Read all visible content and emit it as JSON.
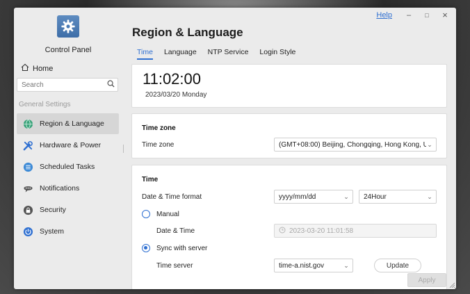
{
  "window": {
    "help_label": "Help",
    "minimize_glyph": "–",
    "maximize_glyph": "□",
    "close_glyph": "×"
  },
  "sidebar": {
    "app_title": "Control Panel",
    "home_label": "Home",
    "search_placeholder": "Search",
    "section_label": "General Settings",
    "items": [
      {
        "label": "Region & Language",
        "icon": "globe-icon",
        "active": true
      },
      {
        "label": "Hardware & Power",
        "icon": "tools-icon",
        "active": false
      },
      {
        "label": "Scheduled Tasks",
        "icon": "task-list-icon",
        "active": false
      },
      {
        "label": "Notifications",
        "icon": "chat-bubble-icon",
        "active": false
      },
      {
        "label": "Security",
        "icon": "lock-icon",
        "active": false
      },
      {
        "label": "System",
        "icon": "power-icon",
        "active": false
      }
    ]
  },
  "main": {
    "page_title": "Region & Language",
    "tabs": [
      {
        "label": "Time",
        "active": true
      },
      {
        "label": "Language",
        "active": false
      },
      {
        "label": "NTP Service",
        "active": false
      },
      {
        "label": "Login Style",
        "active": false
      }
    ],
    "clock": {
      "time": "11:02:00",
      "date": "2023/03/20 Monday"
    },
    "timezone_card": {
      "heading": "Time zone",
      "label": "Time zone",
      "value": "(GMT+08:00) Beijing, Chongqing, Hong Kong, U"
    },
    "time_card": {
      "heading": "Time",
      "format_label": "Date & Time format",
      "date_format_value": "yyyy/mm/dd",
      "hour_format_value": "24Hour",
      "manual_label": "Manual",
      "manual_selected": false,
      "datetime_label": "Date & Time",
      "datetime_value": "2023-03-20 11:01:58",
      "sync_label": "Sync with server",
      "sync_selected": true,
      "time_server_label": "Time server",
      "time_server_value": "time-a.nist.gov",
      "update_label": "Update"
    },
    "apply_label": "Apply"
  },
  "colors": {
    "accent": "#2e6fd1",
    "active_nav": "#d6d6d6",
    "window_bg": "#ebebeb"
  }
}
